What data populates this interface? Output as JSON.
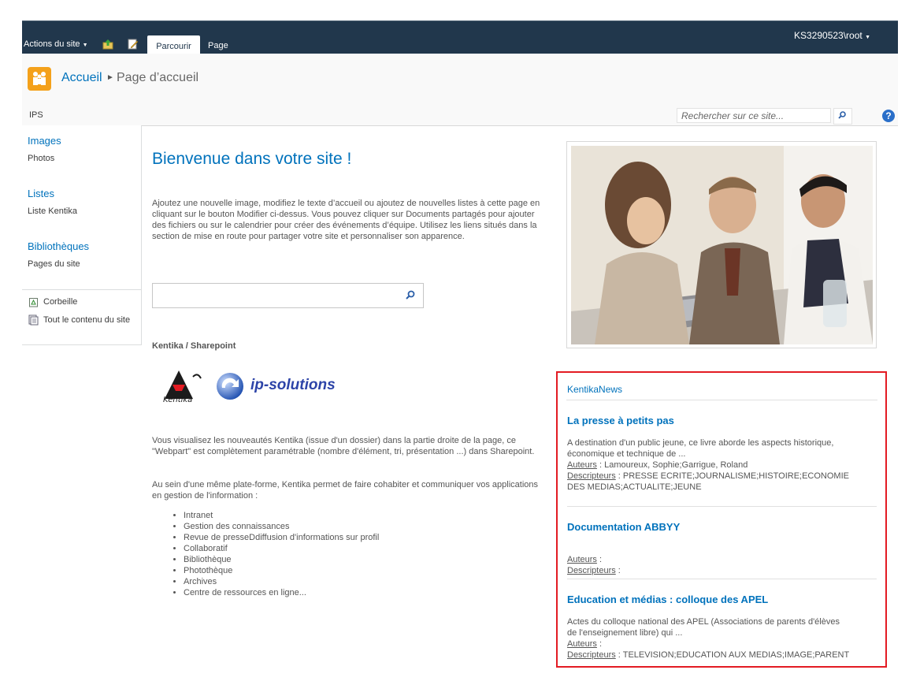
{
  "ribbon": {
    "site_actions": "Actions du site",
    "tab_browse": "Parcourir",
    "tab_page": "Page",
    "user": "KS3290523\\root"
  },
  "breadcrumb": {
    "home": "Accueil",
    "current": "Page d’accueil"
  },
  "topnav": {
    "item": "IPS",
    "search_placeholder": "Rechercher sur ce site..."
  },
  "quicklaunch": {
    "images_head": "Images",
    "images_item": "Photos",
    "lists_head": "Listes",
    "lists_item": "Liste Kentika",
    "libraries_head": "Bibliothèques",
    "libraries_item": "Pages du site",
    "recycle": "Corbeille",
    "all_content": "Tout le contenu du site"
  },
  "main": {
    "welcome": "Bienvenue dans votre site !",
    "intro": "Ajoutez une nouvelle image, modifiez le texte d’accueil ou ajoutez de nouvelles listes à cette page en cliquant sur le bouton Modifier ci-dessus. Vous pouvez cliquer sur Documents partagés pour ajouter des fichiers ou sur le calendrier pour créer des événements d’équipe. Utilisez les liens situés dans la section de mise en route pour partager votre site et personnaliser son apparence.",
    "kentika_title": "Kentika / Sharepoint",
    "ips_logo_text": "ip-solutions",
    "para1": "Vous visualisez les nouveautés Kentika (issue d'un dossier) dans la partie droite de la page, ce \"Webpart\" est complètement paramétrable (nombre d'élément, tri, présentation ...) dans Sharepoint.",
    "para2": "Au sein d'une même plate-forme, Kentika permet de faire cohabiter et communiquer vos applications en gestion de l'information :",
    "features": [
      "Intranet",
      "Gestion des connaissances",
      "Revue de presseDdiffusion d'informations sur profil",
      "Collaboratif",
      "Bibliothèque",
      "Photothèque",
      "Archives",
      "Centre de ressources en ligne..."
    ]
  },
  "news": {
    "header": "KentikaNews",
    "authors_label": "Auteurs",
    "descriptors_label": "Descripteurs",
    "items": [
      {
        "title": "La presse à petits pas",
        "summary": "A destination d'un public jeune, ce livre aborde les aspects historique, économique et technique de ...",
        "authors": " : Lamoureux, Sophie;Garrigue, Roland",
        "descriptors": " : PRESSE ECRITE;JOURNALISME;HISTOIRE;ECONOMIE DES MEDIAS;ACTUALITE;JEUNE"
      },
      {
        "title": "Documentation ABBYY",
        "summary": "",
        "authors": " :",
        "descriptors": " :"
      },
      {
        "title": "Education et médias : colloque des APEL",
        "summary": "Actes du colloque national des APEL (Associations de parents d'élèves de l'enseignement libre) qui ...",
        "authors": " :",
        "descriptors": " : TELEVISION;EDUCATION AUX MEDIAS;IMAGE;PARENT"
      }
    ]
  },
  "colors": {
    "ribbon": "#21374c",
    "link_blue": "#0072bc",
    "highlight_red": "#e31b23",
    "logo_orange": "#f4a11b"
  }
}
